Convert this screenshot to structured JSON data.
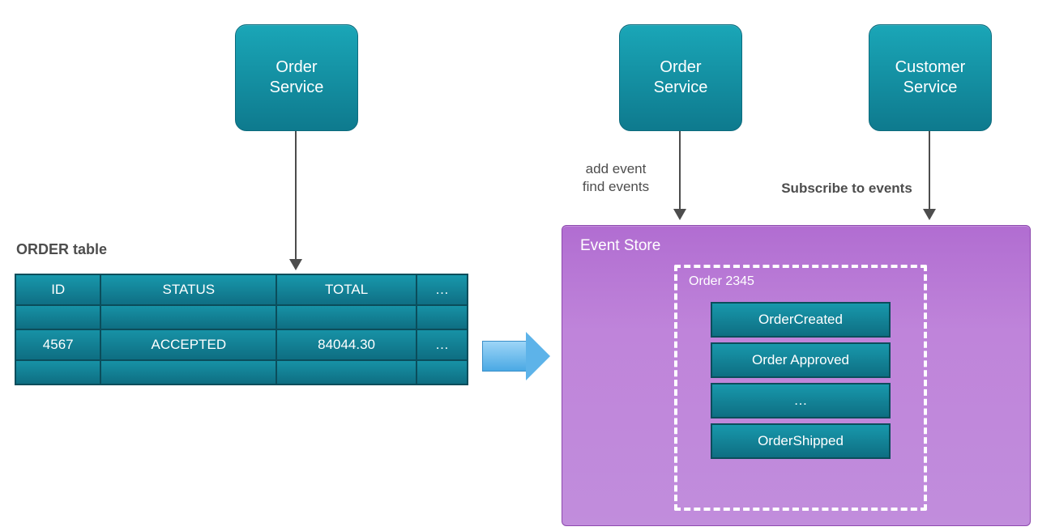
{
  "left": {
    "service_label": "Order\nService",
    "table_caption": "ORDER table",
    "columns": [
      "ID",
      "STATUS",
      "TOTAL",
      "…"
    ],
    "rows": [
      [
        "",
        "",
        "",
        ""
      ],
      [
        "4567",
        "ACCEPTED",
        "84044.30",
        "…"
      ],
      [
        "",
        "",
        "",
        ""
      ]
    ]
  },
  "right": {
    "order_service_label": "Order\nService",
    "customer_service_label": "Customer\nService",
    "order_arrow_caption": "add event\nfind events",
    "customer_arrow_caption": "Subscribe to events",
    "event_store_title": "Event Store",
    "order_group_title": "Order 2345",
    "events": [
      "OrderCreated",
      "Order Approved",
      "…",
      "OrderShipped"
    ]
  }
}
